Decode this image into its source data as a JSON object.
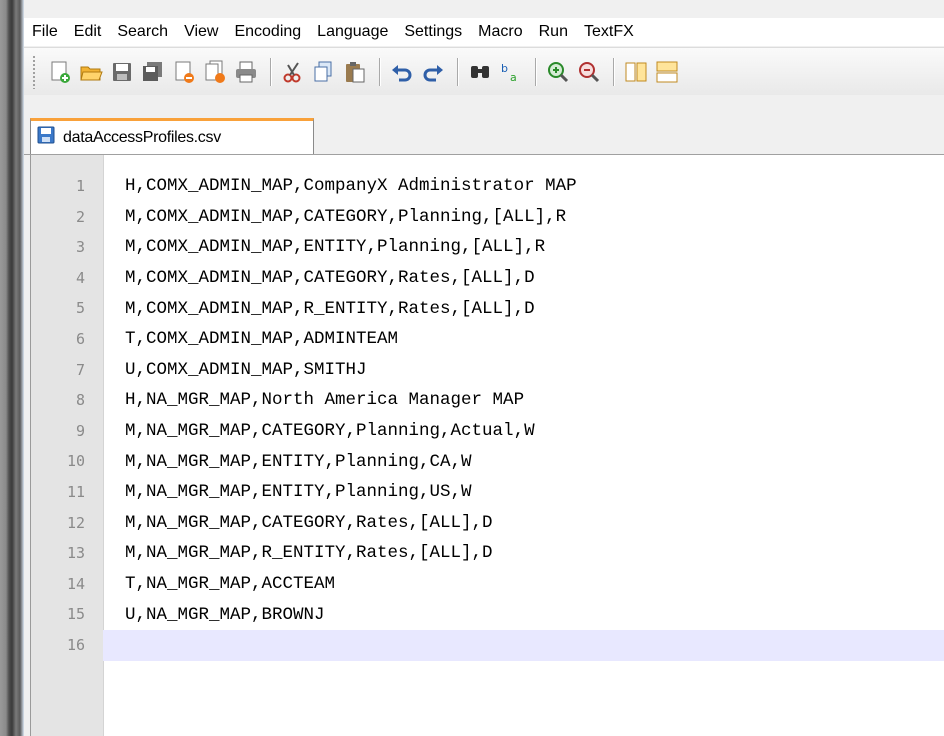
{
  "menu": [
    "File",
    "Edit",
    "Search",
    "View",
    "Encoding",
    "Language",
    "Settings",
    "Macro",
    "Run",
    "TextFX"
  ],
  "toolbar": {
    "buttons": [
      {
        "name": "new-file-icon"
      },
      {
        "name": "open-file-icon"
      },
      {
        "name": "save-icon"
      },
      {
        "name": "save-all-icon"
      },
      {
        "name": "close-icon"
      },
      {
        "name": "close-all-icon"
      },
      {
        "name": "print-icon"
      },
      {
        "sep": true
      },
      {
        "name": "cut-icon"
      },
      {
        "name": "copy-icon"
      },
      {
        "name": "paste-icon"
      },
      {
        "sep": true
      },
      {
        "name": "undo-icon"
      },
      {
        "name": "redo-icon"
      },
      {
        "sep": true
      },
      {
        "name": "find-icon"
      },
      {
        "name": "replace-icon"
      },
      {
        "sep": true
      },
      {
        "name": "zoom-in-icon"
      },
      {
        "name": "zoom-out-icon"
      },
      {
        "sep": true
      },
      {
        "name": "sync-vertical-icon"
      },
      {
        "name": "sync-horizontal-icon"
      }
    ]
  },
  "tab": {
    "label": "dataAccessProfiles.csv",
    "icon": "save-icon"
  },
  "editor": {
    "current_line": 16,
    "lines": [
      {
        "num": "1",
        "text": "H,COMX_ADMIN_MAP,CompanyX Administrator MAP"
      },
      {
        "num": "2",
        "text": "M,COMX_ADMIN_MAP,CATEGORY,Planning,[ALL],R"
      },
      {
        "num": "3",
        "text": "M,COMX_ADMIN_MAP,ENTITY,Planning,[ALL],R"
      },
      {
        "num": "4",
        "text": "M,COMX_ADMIN_MAP,CATEGORY,Rates,[ALL],D"
      },
      {
        "num": "5",
        "text": "M,COMX_ADMIN_MAP,R_ENTITY,Rates,[ALL],D"
      },
      {
        "num": "6",
        "text": "T,COMX_ADMIN_MAP,ADMINTEAM"
      },
      {
        "num": "7",
        "text": "U,COMX_ADMIN_MAP,SMITHJ"
      },
      {
        "num": "8",
        "text": "H,NA_MGR_MAP,North America Manager MAP"
      },
      {
        "num": "9",
        "text": "M,NA_MGR_MAP,CATEGORY,Planning,Actual,W"
      },
      {
        "num": "10",
        "text": "M,NA_MGR_MAP,ENTITY,Planning,CA,W"
      },
      {
        "num": "11",
        "text": "M,NA_MGR_MAP,ENTITY,Planning,US,W"
      },
      {
        "num": "12",
        "text": "M,NA_MGR_MAP,CATEGORY,Rates,[ALL],D"
      },
      {
        "num": "13",
        "text": "M,NA_MGR_MAP,R_ENTITY,Rates,[ALL],D"
      },
      {
        "num": "14",
        "text": "T,NA_MGR_MAP,ACCTEAM"
      },
      {
        "num": "15",
        "text": "U,NA_MGR_MAP,BROWNJ"
      },
      {
        "num": "16",
        "text": ""
      }
    ]
  }
}
